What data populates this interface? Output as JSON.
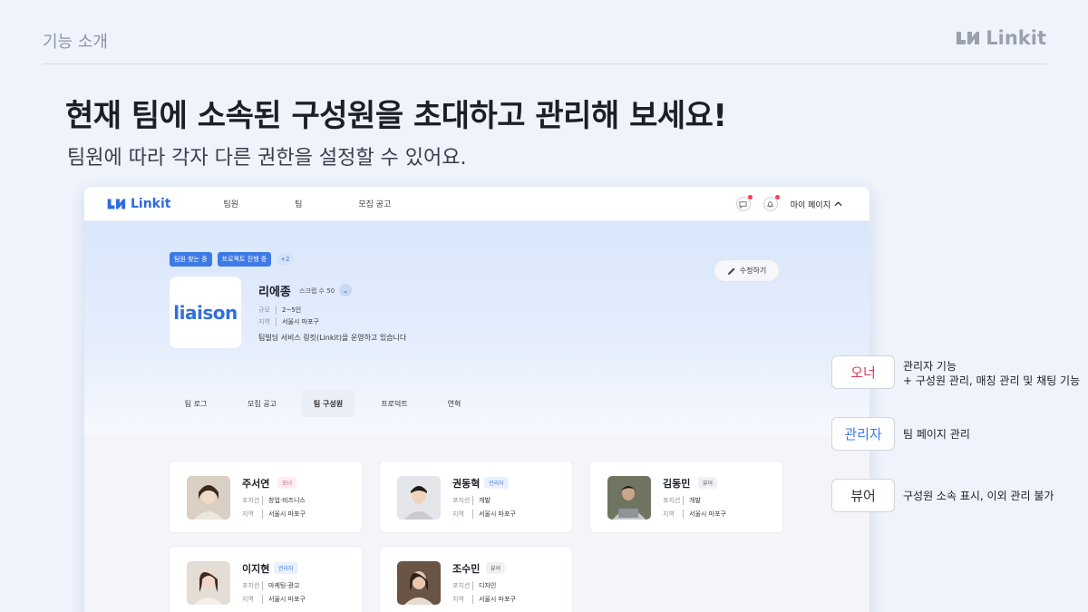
{
  "slide": {
    "label": "기능 소개",
    "brand": "Linkit",
    "headline_pre": "현재 팀에 소속된 ",
    "headline_bold": "구성원",
    "headline_post": "을 초대하고 관리해 보세요!",
    "subheadline": "팀원에 따라 각자 다른 권한을 설정할 수 있어요."
  },
  "app": {
    "logo": "Linkit",
    "nav": [
      "팀원",
      "팀",
      "모집 공고"
    ],
    "mypage": "마이 페이지",
    "team": {
      "tags": [
        "팀원 찾는 중",
        "프로젝트 진행 중"
      ],
      "more": "+2",
      "logo_text": "liaison",
      "name": "리에종",
      "scrap": "스크랩 수 50",
      "size_label": "규모",
      "size": "2~5인",
      "region_label": "지역",
      "region": "서울시 마포구",
      "description": "팀빌딩 서비스 링킷(Linkit)을 운영하고 있습니다",
      "edit": "수정하기"
    },
    "tabs": [
      "팀 로그",
      "모집 공고",
      "팀 구성원",
      "프로덕트",
      "연혁"
    ],
    "members": [
      {
        "name": "주서연",
        "role": "오너",
        "position_label": "포지션",
        "position": "창업·비즈니스",
        "region_label": "지역",
        "region": "서울시 마포구"
      },
      {
        "name": "권동혁",
        "role": "관리자",
        "position_label": "포지션",
        "position": "개발",
        "region_label": "지역",
        "region": "서울시 마포구"
      },
      {
        "name": "김동민",
        "role": "뷰어",
        "position_label": "포지션",
        "position": "개발",
        "region_label": "지역",
        "region": "서울시 마포구"
      },
      {
        "name": "이지현",
        "role": "관리자",
        "position_label": "포지션",
        "position": "마케팅·광고",
        "region_label": "지역",
        "region": "서울시 마포구"
      },
      {
        "name": "조수민",
        "role": "뷰어",
        "position_label": "포지션",
        "position": "디자인",
        "region_label": "지역",
        "region": "서울시 마포구"
      }
    ]
  },
  "roles_legend": [
    {
      "role": "오너",
      "desc_line1": "관리자 기능",
      "desc_line2": "+ 구성원 관리, 매칭 관리 및 채팅 기능",
      "color": "#e6355a"
    },
    {
      "role": "관리자",
      "desc_line1": "팀 페이지 관리",
      "desc_line2": "",
      "color": "#3e7ae6"
    },
    {
      "role": "뷰어",
      "desc_line1": "구성원 소속 표시, 이외 관리 불가",
      "desc_line2": "",
      "color": "#333333"
    }
  ]
}
